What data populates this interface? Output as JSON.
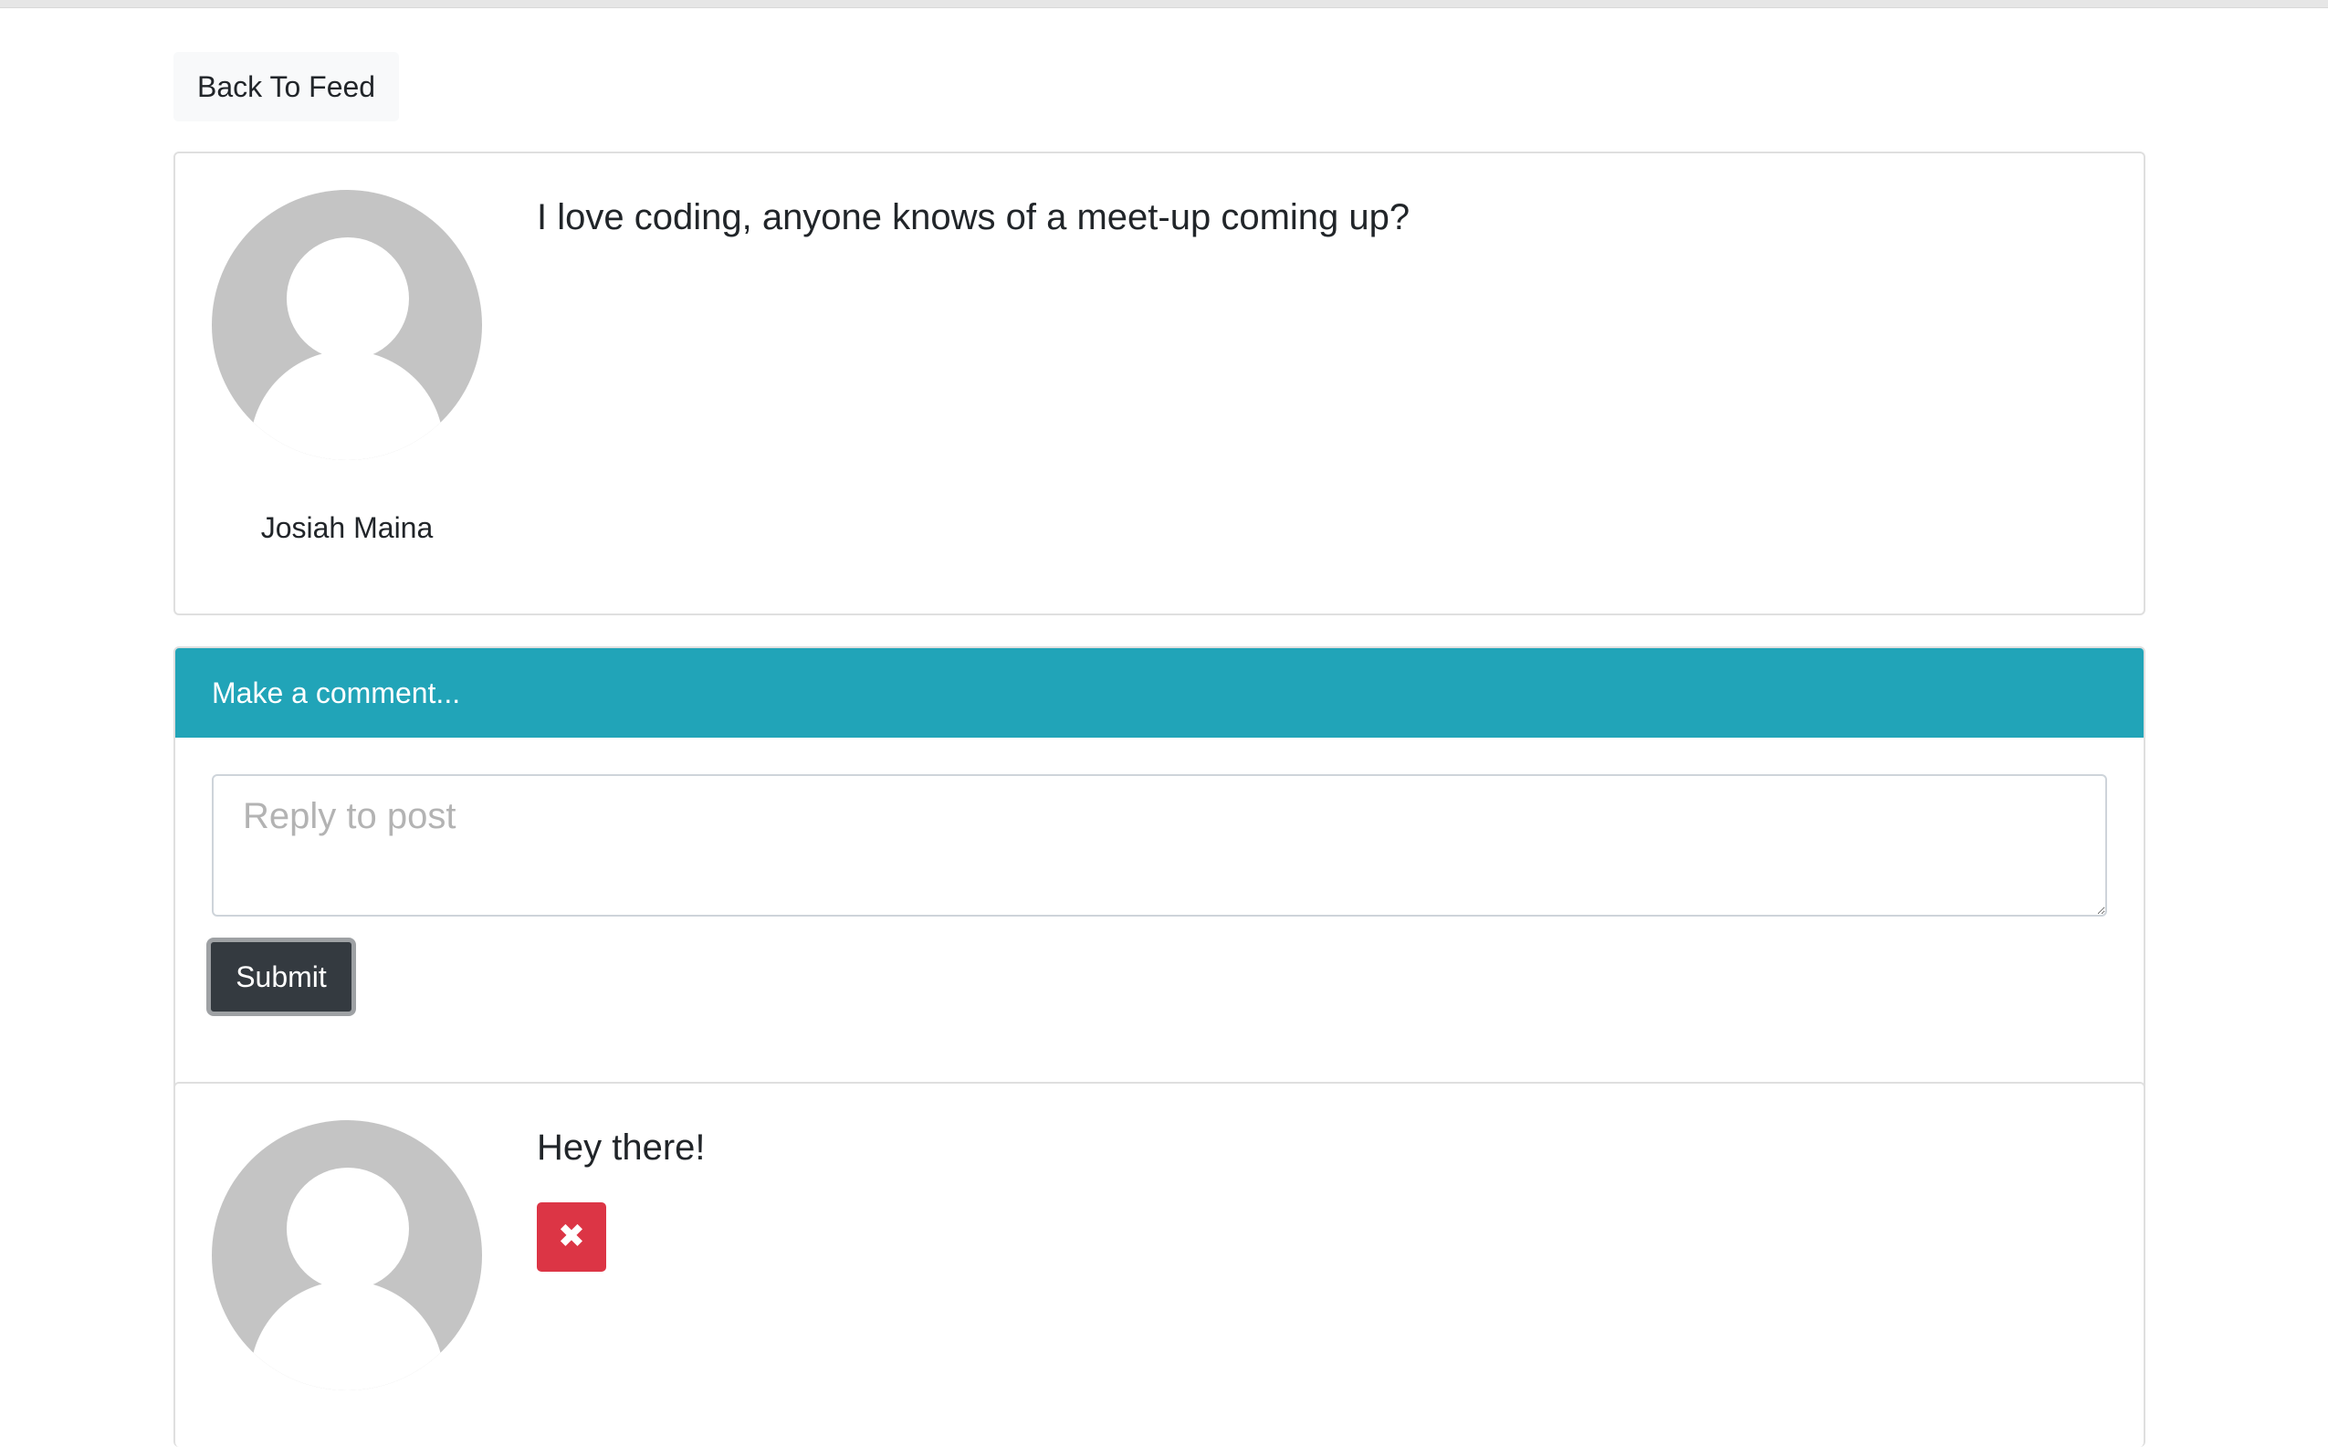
{
  "nav": {
    "back_label": "Back To Feed"
  },
  "post": {
    "text": "I love coding, anyone knows of a meet-up coming up?",
    "author": "Josiah Maina",
    "avatar_icon": "default-user-avatar-icon"
  },
  "comment_form": {
    "header": "Make a comment...",
    "placeholder": "Reply to post",
    "value": "",
    "submit_label": "Submit"
  },
  "comments": [
    {
      "text": "Hey there!",
      "avatar_icon": "default-user-avatar-icon",
      "delete_icon": "close-icon",
      "delete_glyph": "✖"
    }
  ],
  "colors": {
    "header_bg": "#21a4b8",
    "submit_bg": "#343a40",
    "delete_bg": "#dc3545",
    "avatar_bg": "#c4c4c4"
  }
}
